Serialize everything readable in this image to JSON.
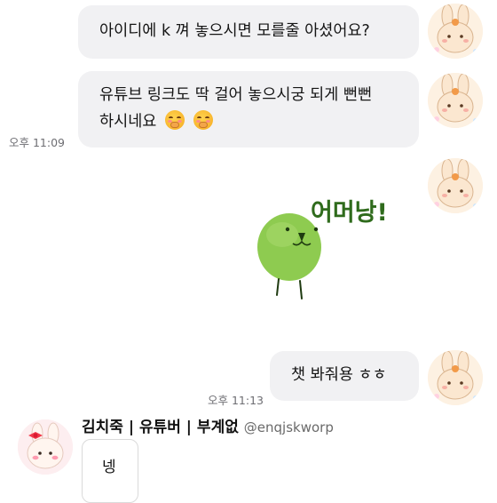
{
  "messages": [
    {
      "text": "아이디에 k 껴 놓으시면 모를줄 아셨어요?"
    },
    {
      "line1": "유튜브 링크도 딱 걸어 놓으시궁 되게 뻔뻔",
      "line2": "하시네요",
      "time": "오후 11:09"
    },
    {
      "sticker_text": "어머낭!"
    },
    {
      "text": "챗 봐줘용 ㅎㅎ",
      "time": "오후 11:13"
    }
  ],
  "reply_preview": {
    "sender_name": "김치죽 | 유튜버 | 부계없",
    "sender_handle": "@enqjskworp",
    "text": "넹"
  },
  "colors": {
    "bubble": "#f1f1f3",
    "sticker_green": "#8ecb50",
    "sticker_text": "#2f6b1c"
  },
  "icons": [
    "shushing-face-emoji",
    "bunny-avatar",
    "green-blob-sticker"
  ]
}
